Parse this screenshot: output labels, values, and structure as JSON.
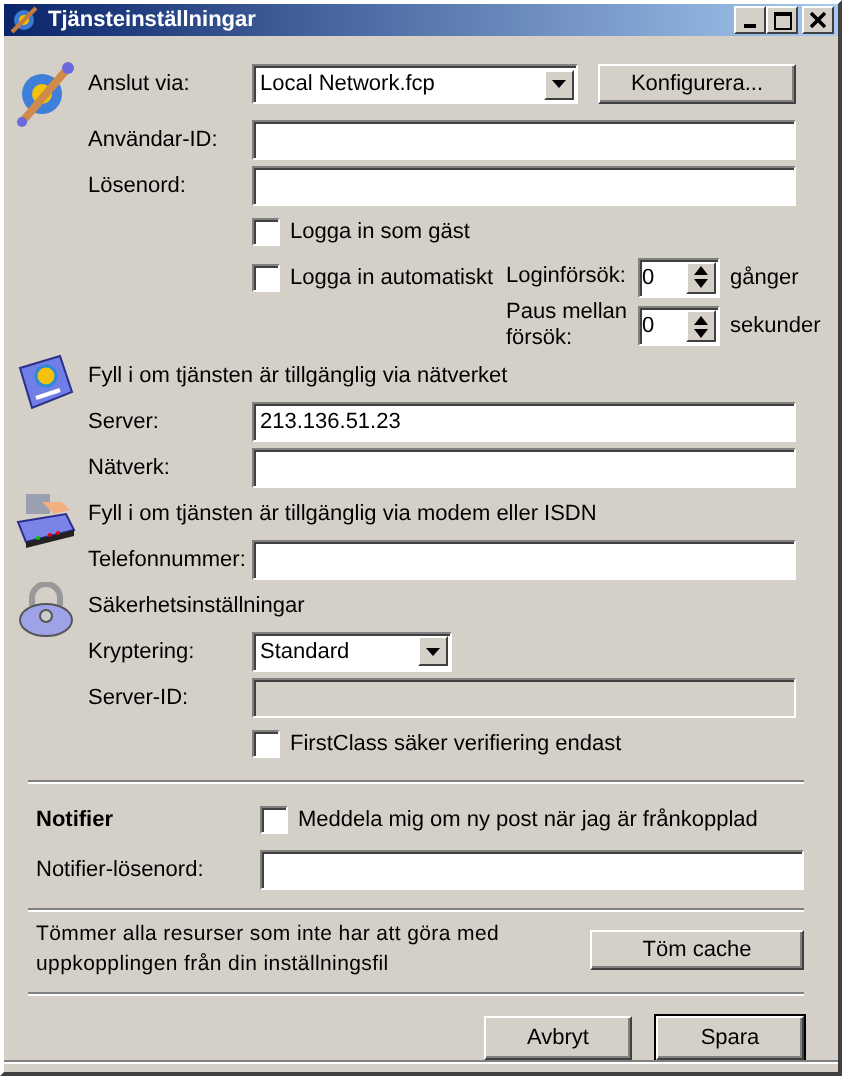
{
  "window": {
    "title": "Tjänsteinställningar"
  },
  "connection": {
    "label": "Anslut via:",
    "value": "Local Network.fcp",
    "configure_button": "Konfigurera...",
    "fields": [
      {
        "label": "Användar-ID:",
        "disabled": false
      },
      {
        "label": "Lösenord:",
        "disabled": false
      }
    ],
    "guest": {
      "label": "Logga in som gäst",
      "checked": false
    },
    "auto": {
      "label": "Logga in automatiskt",
      "checked": false
    },
    "spinners": [
      {
        "label": "Loginförsök:",
        "value": "0",
        "unit": "gånger"
      },
      {
        "label": "Paus mellan försök:",
        "value": "0",
        "unit": "sekunder"
      }
    ]
  },
  "network": {
    "title": "Fyll i om tjänsten är tillgänglig via nätverket",
    "fields": [
      {
        "label": "Server:",
        "value": "213.136.51.23",
        "disabled": false
      },
      {
        "label": "Nätverk:",
        "disabled": false
      }
    ]
  },
  "modem": {
    "title": "Fyll i om tjänsten är tillgänglig via modem eller ISDN",
    "fields": [
      {
        "label": "Telefonnummer:",
        "disabled": false
      }
    ]
  },
  "security": {
    "title": "Säkerhetsinställningar",
    "encryption": {
      "label": "Kryptering:",
      "value": "Standard"
    },
    "fields": [
      {
        "label": "Server-ID:",
        "disabled": true
      }
    ],
    "verify": {
      "label": "FirstClass säker verifiering endast",
      "checked": false
    }
  },
  "notifier": {
    "title": "Notifier",
    "notify": {
      "label": "Meddela mig om ny post när jag är frånkopplad",
      "checked": false
    },
    "fields": [
      {
        "label": "Notifier-lösenord:",
        "disabled": false
      }
    ]
  },
  "cache": {
    "text": "Tömmer alla resurser som inte har att göra med uppkopplingen från din inställningsfil",
    "button": "Töm cache"
  },
  "buttons": [
    {
      "label": "Avbryt",
      "default": false
    },
    {
      "label": "Spara",
      "default": true
    }
  ]
}
